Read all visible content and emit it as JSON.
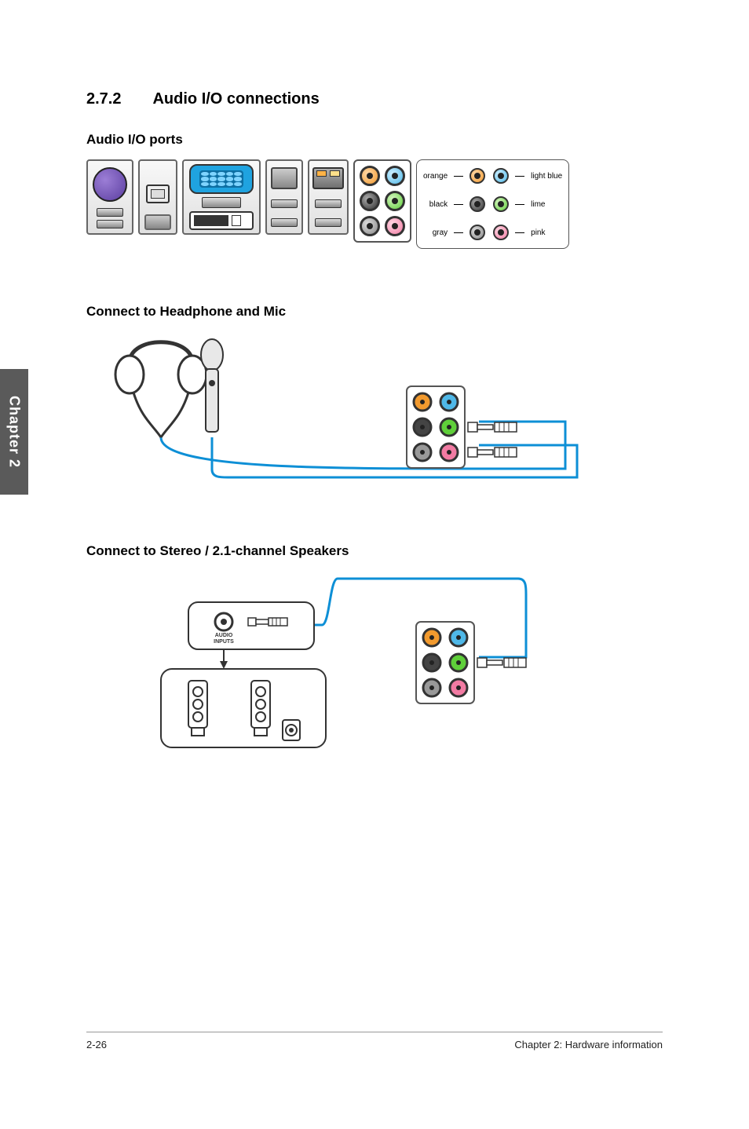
{
  "section": {
    "number": "2.7.2",
    "title": "Audio I/O connections"
  },
  "sub1": "Audio I/O ports",
  "sub2": "Connect to Headphone and Mic",
  "sub3": "Connect to Stereo / 2.1-channel Speakers",
  "legend": {
    "orange": "orange",
    "black": "black",
    "gray": "gray",
    "lightblue": "light blue",
    "lime": "lime",
    "pink": "pink"
  },
  "speakerbox_label": "AUDIO\nINPUTS",
  "chapter_tab": "Chapter 2",
  "footer": {
    "page": "2-26",
    "chapter": "Chapter 2: Hardware information"
  }
}
